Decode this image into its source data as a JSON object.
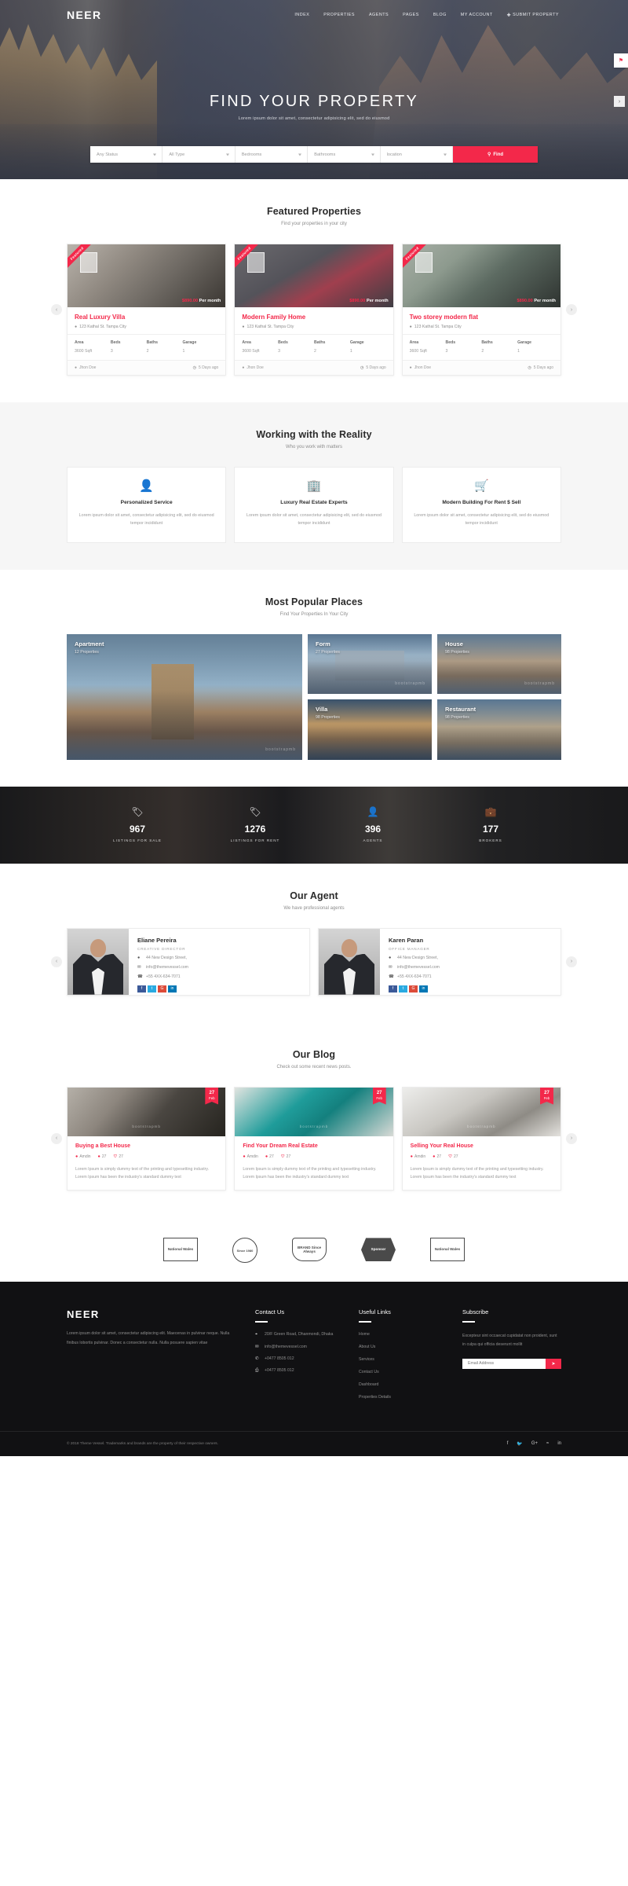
{
  "header": {
    "brand": "NEER",
    "nav": [
      {
        "label": "INDEX"
      },
      {
        "label": "PROPERTIES"
      },
      {
        "label": "AGENTS"
      },
      {
        "label": "PAGES"
      },
      {
        "label": "BLOG"
      },
      {
        "label": "MY ACCOUNT"
      },
      {
        "label": "SUBMIT PROPERTY",
        "plus": "✚"
      }
    ]
  },
  "hero": {
    "title": "FIND YOUR PROPERTY",
    "subtitle": "Lorem ipsum dolor sit amet, consectetur adipisicing elit, sed do eiusmod",
    "search": {
      "status": "Any Status",
      "type": "All Type",
      "bedrooms": "Bedrooms",
      "bathrooms": "Bathrooms",
      "location": "location",
      "find_label": "Find",
      "find_icon": "search-icon"
    },
    "side_cart_icon": "cart-icon",
    "side_next_icon": "chevron-right-icon"
  },
  "featured": {
    "title": "Featured Properties",
    "subtitle": "Find your properties in your city",
    "items": [
      {
        "ribbon": "Featured",
        "price_amount": "$890.00",
        "price_unit": "Per month",
        "title": "Real Luxury Villa",
        "address": "123 Kathal St. Tampa City",
        "specs": [
          {
            "key": "Area",
            "value": "3600 Sqft"
          },
          {
            "key": "Beds",
            "value": "3"
          },
          {
            "key": "Baths",
            "value": "2"
          },
          {
            "key": "Garage",
            "value": "1"
          }
        ],
        "agent": "Jhon Doe",
        "time": "5 Days ago"
      },
      {
        "ribbon": "Featured",
        "price_amount": "$890.00",
        "price_unit": "Per month",
        "title": "Modern Family Home",
        "address": "123 Kathal St. Tampa City",
        "specs": [
          {
            "key": "Area",
            "value": "3600 Sqft"
          },
          {
            "key": "Beds",
            "value": "3"
          },
          {
            "key": "Baths",
            "value": "2"
          },
          {
            "key": "Garage",
            "value": "1"
          }
        ],
        "agent": "Jhon Doe",
        "time": "5 Days ago"
      },
      {
        "ribbon": "Featured",
        "price_amount": "$890.00",
        "price_unit": "Per month",
        "title": "Two storey modern flat",
        "address": "123 Kathal St. Tampa City",
        "specs": [
          {
            "key": "Area",
            "value": "3600 Sqft"
          },
          {
            "key": "Beds",
            "value": "3"
          },
          {
            "key": "Baths",
            "value": "2"
          },
          {
            "key": "Garage",
            "value": "1"
          }
        ],
        "agent": "Jhon Doe",
        "time": "5 Days ago"
      }
    ],
    "prev_icon": "chevron-left-icon",
    "next_icon": "chevron-right-icon"
  },
  "services": {
    "title": "Working with the Reality",
    "subtitle": "Who you work with matters",
    "items": [
      {
        "icon": "user-icon",
        "glyph": "👤",
        "name": "Personalized Service",
        "text": "Lorem ipsum dolor sit amet, consectetur adipisicing elit, sed do eiusmod tempor incididunt"
      },
      {
        "icon": "building-icon",
        "glyph": "🏢",
        "name": "Luxury Real Estate Experts",
        "text": "Lorem ipsum dolor sit amet, consectetur adipisicing elit, sed do eiusmod tempor incididunt"
      },
      {
        "icon": "cart-icon",
        "glyph": "🛒",
        "name": "Modern Building For Rent $ Sell",
        "text": "Lorem ipsum dolor sit amet, consectetur adipisicing elit, sed do eiusmod tempor incididunt"
      }
    ]
  },
  "places": {
    "title": "Most Popular Places",
    "subtitle": "Find Your Properties In Your City",
    "watermark": "bootstrapmb",
    "items": [
      {
        "name": "Apartment",
        "count": "12 Properties"
      },
      {
        "name": "Form",
        "count": "27 Properties"
      },
      {
        "name": "House",
        "count": "98 Properties"
      },
      {
        "name": "Villa",
        "count": "98 Properties"
      },
      {
        "name": "Restaurant",
        "count": "98 Properties"
      }
    ]
  },
  "stats": [
    {
      "icon": "sale-tag-icon",
      "glyph": "🏷",
      "number": "967",
      "label": "LISTINGS FOR SALE"
    },
    {
      "icon": "rent-tag-icon",
      "glyph": "🏷",
      "number": "1276",
      "label": "LISTINGS FOR RENT"
    },
    {
      "icon": "agent-icon",
      "glyph": "👤",
      "number": "396",
      "label": "AGENTS"
    },
    {
      "icon": "broker-icon",
      "glyph": "💼",
      "number": "177",
      "label": "BROKERS"
    }
  ],
  "agents": {
    "title": "Our Agent",
    "subtitle": "We have professional agents",
    "items": [
      {
        "name": "Eliane Pereira",
        "role": "CREATIVE DIRECTOR",
        "address": "44 New Design Street,",
        "email": "info@themevessel.com",
        "phone": "+55 4XX-634-7071",
        "social": [
          "f",
          "t",
          "G",
          "in"
        ]
      },
      {
        "name": "Karen Paran",
        "role": "OFFICE MANAGER",
        "address": "44 New Design Street,",
        "email": "info@themevessel.com",
        "phone": "+55 4XX-634-7071",
        "social": [
          "f",
          "t",
          "G",
          "in"
        ]
      }
    ],
    "prev_icon": "chevron-left-icon",
    "next_icon": "chevron-right-icon"
  },
  "blog": {
    "title": "Our Blog",
    "subtitle": "Check out some recent news posts.",
    "watermark": "bootstrapmb",
    "items": [
      {
        "day": "27",
        "month": "Feb",
        "title": "Buying a Best House",
        "author": "Amdin",
        "comments": "27",
        "likes": "27",
        "text": "Lorem Ipsum is simply dummy text of the printing and typesetting industry. Lorem Ipsum has been the industry's standard dummy text"
      },
      {
        "day": "27",
        "month": "Feb",
        "title": "Find Your Dream Real Estate",
        "author": "Amdin",
        "comments": "27",
        "likes": "27",
        "text": "Lorem Ipsum is simply dummy text of the printing and typesetting industry. Lorem Ipsum has been the industry's standard dummy text"
      },
      {
        "day": "27",
        "month": "Feb",
        "title": "Selling Your Real House",
        "author": "Amdin",
        "comments": "27",
        "likes": "27",
        "text": "Lorem Ipsum is simply dummy text of the printing and typesetting industry. Lorem Ipsum has been the industry's standard dummy text"
      }
    ],
    "prev_icon": "chevron-left-icon",
    "next_icon": "chevron-right-icon"
  },
  "partners": [
    {
      "name": "National Wales"
    },
    {
      "name": "Since 1980"
    },
    {
      "name": "BRAND Since Always"
    },
    {
      "name": "Sponsor"
    },
    {
      "name": "National Wales"
    }
  ],
  "footer": {
    "brand": "NEER",
    "about": "Lorem ipsum dolor sit amet, consectetur adipiscing elit. Maecenas in pulvinar neque. Nulla finibus lobortis pulvinar. Donec a consectetur nulla. Nulla posuere sapien vitae",
    "contact": {
      "heading": "Contact Us",
      "rows": [
        {
          "icon": "location-pin-icon",
          "glyph": "⌖",
          "text": "20/F Green Road, Dhanmondi, Dhaka"
        },
        {
          "icon": "envelope-icon",
          "glyph": "✉",
          "text": "info@themevessel.com"
        },
        {
          "icon": "phone-icon",
          "glyph": "✆",
          "text": "+0477 8505 012"
        },
        {
          "icon": "fax-icon",
          "glyph": "⎙",
          "text": "+0477 8505 012"
        }
      ]
    },
    "useful": {
      "heading": "Useful Links",
      "links": [
        "Home",
        "About Us",
        "Services",
        "Contact Us",
        "Dashboard",
        "Properties Details"
      ]
    },
    "subscribe": {
      "heading": "Subscribe",
      "text": "Excepteur sint occaecat cupidatat non proident, sunt in culpa qui officia deserunt mollit",
      "placeholder": "Email Address",
      "button_icon": "send-icon",
      "button_glyph": "➤"
    },
    "copyright": "© 2018 Theme Vessel. Trademarks and brands are the property of their respective owners.",
    "social": [
      {
        "icon": "facebook-icon",
        "glyph": "f"
      },
      {
        "icon": "twitter-icon",
        "glyph": "🐦"
      },
      {
        "icon": "google-plus-icon",
        "glyph": "G+"
      },
      {
        "icon": "rss-icon",
        "glyph": "≈"
      },
      {
        "icon": "linkedin-icon",
        "glyph": "in"
      }
    ]
  },
  "colors": {
    "accent": "#f3284a",
    "dark": "#141414",
    "footer": "#111113"
  }
}
